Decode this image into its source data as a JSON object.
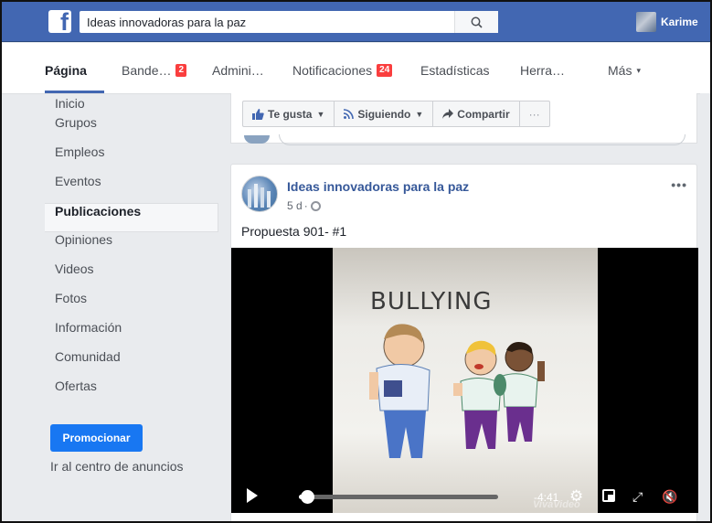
{
  "topbar": {
    "logo_letter": "f",
    "search": {
      "value": "Ideas innovadoras para la paz",
      "icon": "search-icon"
    },
    "user": {
      "name": "Karime"
    },
    "colors": {
      "brand": "#4267b2"
    }
  },
  "tabs": [
    {
      "label": "Página",
      "badge": null
    },
    {
      "label": "Bande…",
      "badge": "2"
    },
    {
      "label": "Admini…",
      "badge": null
    },
    {
      "label": "Notificaciones",
      "badge": "24"
    },
    {
      "label": "Estadísticas",
      "badge": null
    },
    {
      "label": "Herra…",
      "badge": null
    },
    {
      "label": "Más",
      "caret": "▾"
    }
  ],
  "sidebar": {
    "items": [
      {
        "label": "Inicio"
      },
      {
        "label": "Grupos"
      },
      {
        "label": "Empleos"
      },
      {
        "label": "Eventos"
      },
      {
        "label": "Publicaciones"
      },
      {
        "label": "Opiniones"
      },
      {
        "label": "Videos"
      },
      {
        "label": "Fotos"
      },
      {
        "label": "Información"
      },
      {
        "label": "Comunidad"
      },
      {
        "label": "Ofertas"
      }
    ],
    "promote_label": "Promocionar",
    "ad_center_label": "Ir al centro de anuncios"
  },
  "actions": {
    "like": "Te gusta",
    "following": "Siguiendo",
    "share": "Compartir",
    "more": "···"
  },
  "post": {
    "author": "Ideas innovadoras para la paz",
    "time": "5 d",
    "separator": "·",
    "menu": "•••",
    "text": "Propuesta 901- #1",
    "video": {
      "title_in_frame": "BULLYING",
      "time_remaining": "-4:41",
      "watermark": "VivaVideo",
      "progress": 0.04
    }
  }
}
